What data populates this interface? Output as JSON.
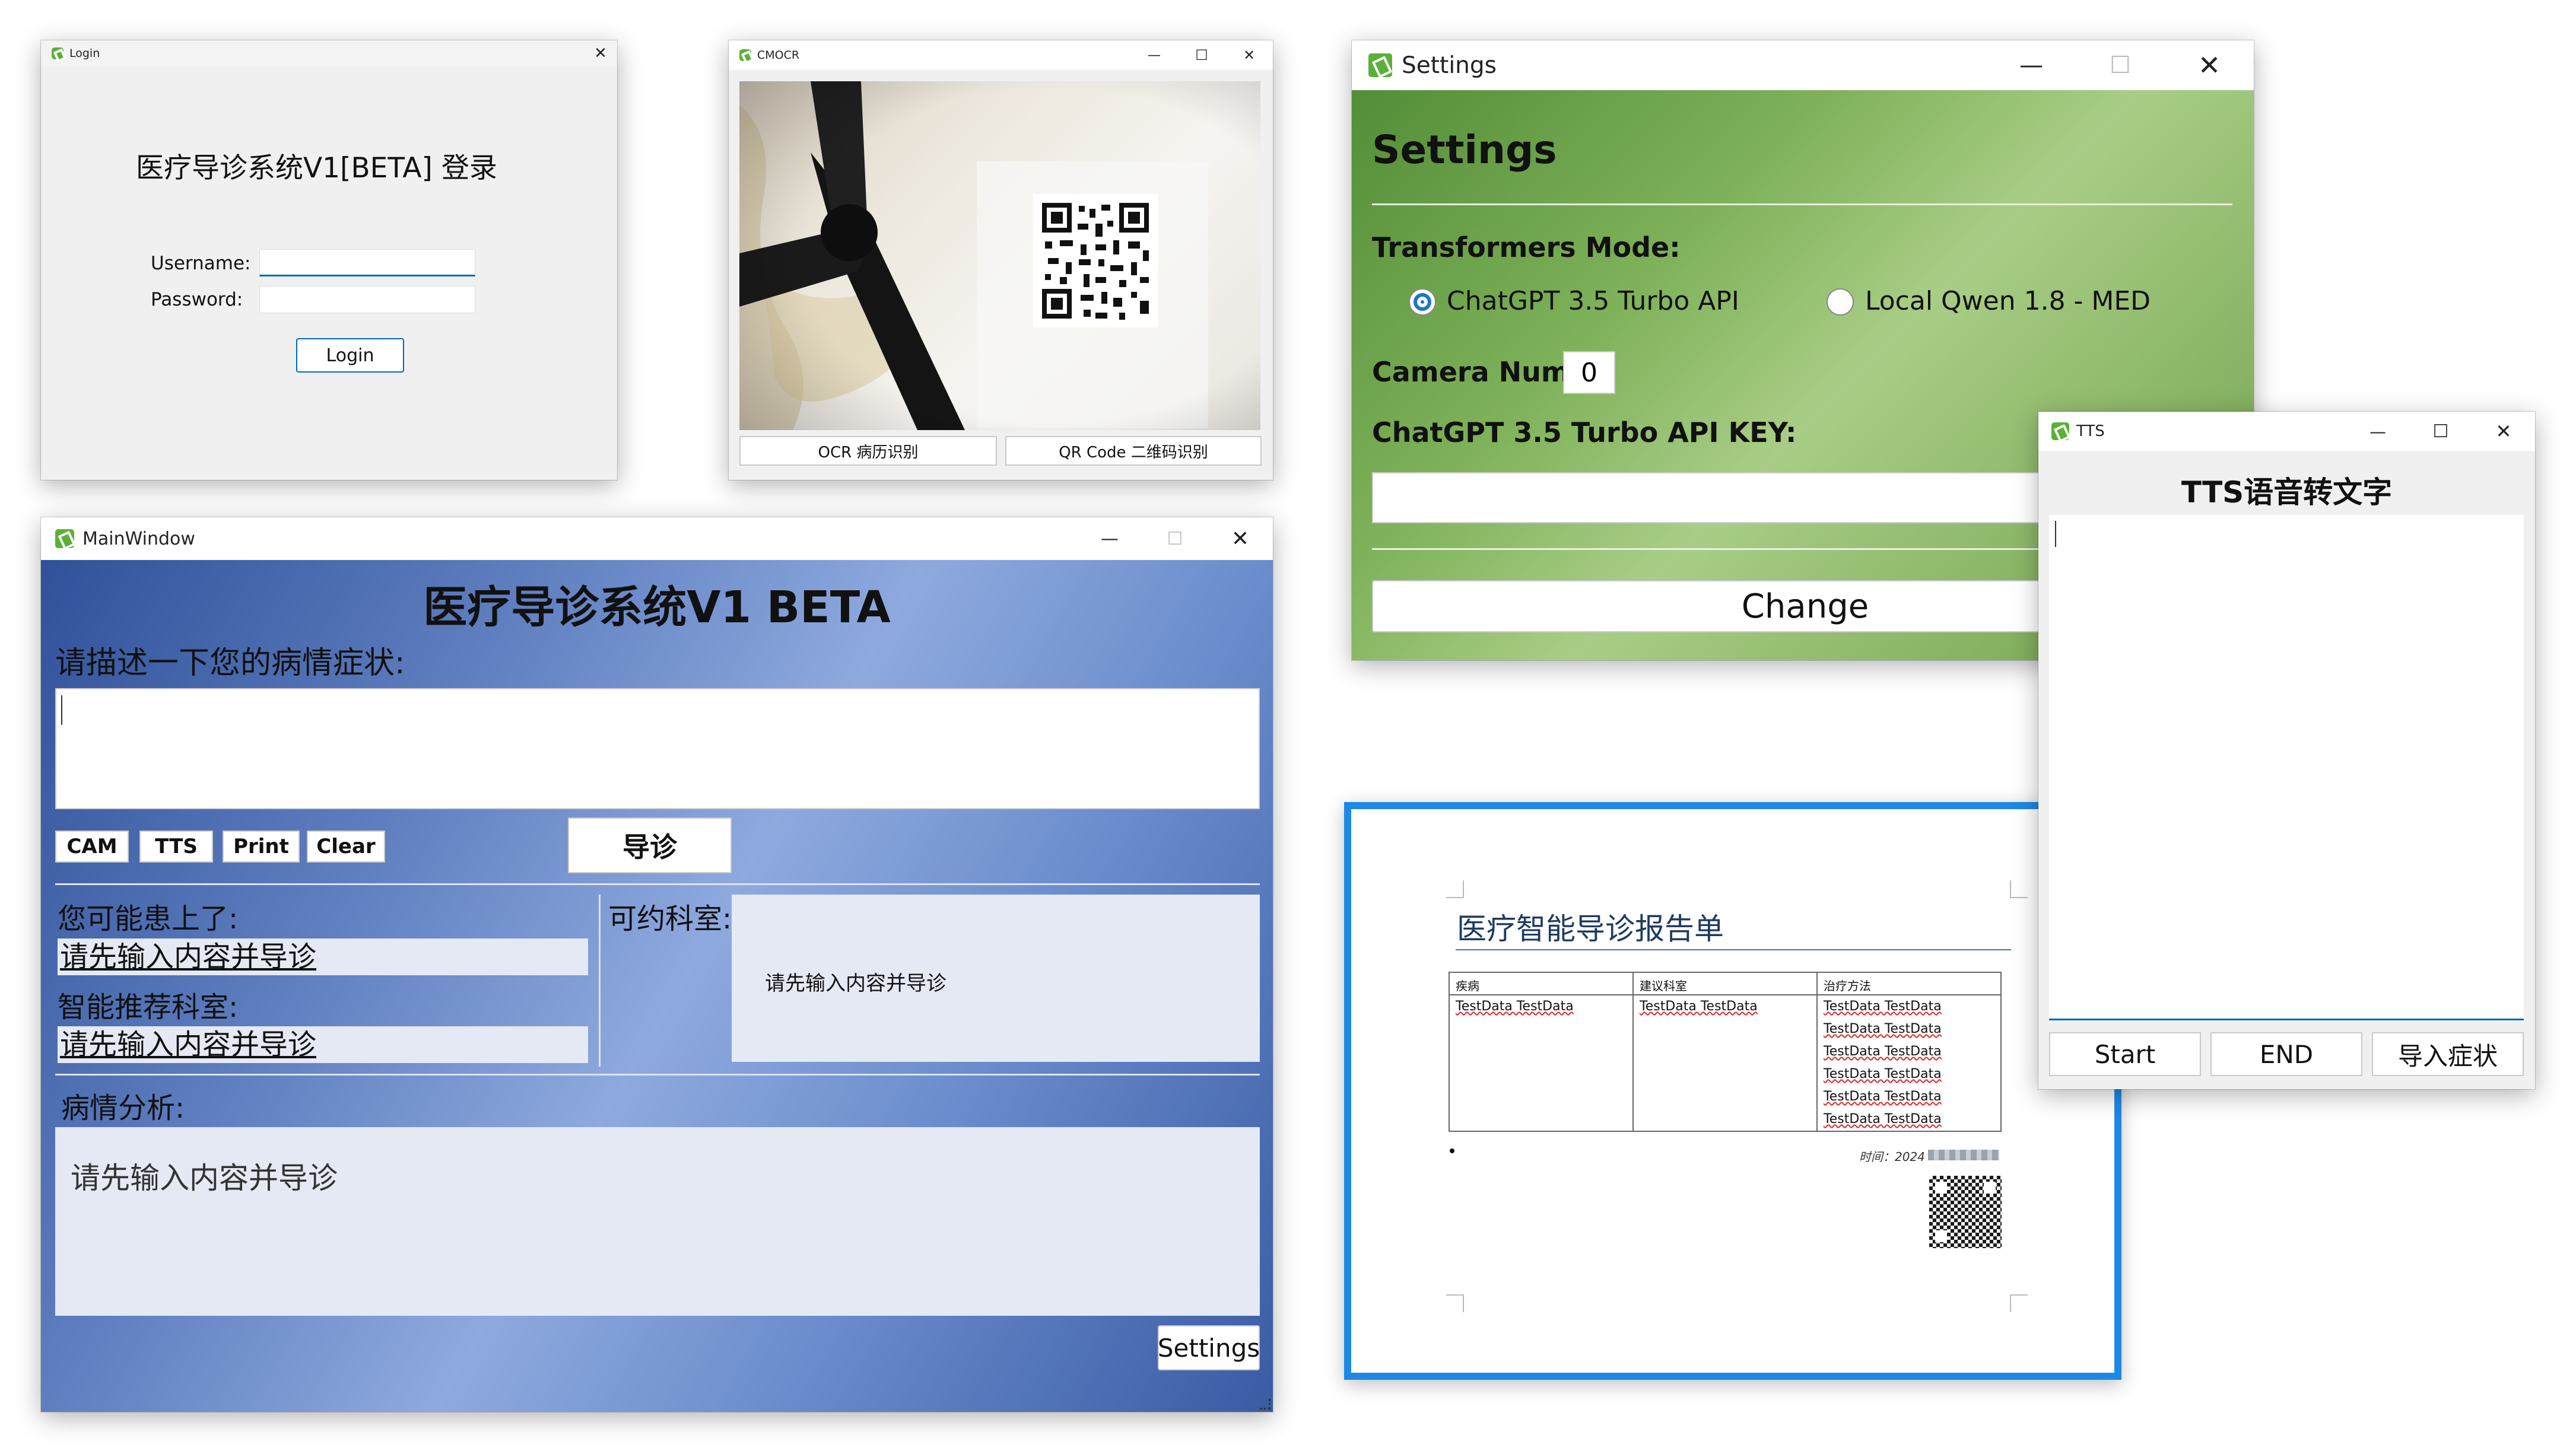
{
  "login": {
    "window_title": "Login",
    "heading": "医疗导诊系统V1[BETA] 登录",
    "username_label": "Username:",
    "password_label": "Password:",
    "username_value": "",
    "password_value": "",
    "login_button": "Login"
  },
  "cmocr": {
    "window_title": "CMOCR",
    "ocr_button": "OCR 病历识别",
    "qr_button": "QR Code 二维码识别"
  },
  "settings": {
    "window_title": "Settings",
    "heading": "Settings",
    "mode_label": "Transformers Mode:",
    "mode_options": [
      "ChatGPT 3.5 Turbo API",
      "Local Qwen 1.8 - MED"
    ],
    "selected_mode": "ChatGPT 3.5 Turbo API",
    "camera_label": "Camera Num:",
    "camera_value": "0",
    "api_key_label": "ChatGPT 3.5 Turbo API KEY:",
    "api_key_value": "",
    "change_button": "Change",
    "gradient_colors": [
      "#4f8a34",
      "#a9cd86"
    ]
  },
  "main": {
    "window_title": "MainWindow",
    "title": "医疗导诊系统V1 BETA",
    "describe_label": "请描述一下您的病情症状:",
    "describe_value": "",
    "buttons": {
      "cam": "CAM",
      "tts": "TTS",
      "print": "Print",
      "clear": "Clear",
      "diagnose": "导诊"
    },
    "possible_label": "您可能患上了:",
    "possible_value": "请先输入内容并导诊",
    "dept_label": "智能推荐科室:",
    "dept_value": "请先输入内容并导诊",
    "bookable_label": "可约科室:",
    "bookable_value": "请先输入内容并导诊",
    "analysis_label": "病情分析:",
    "analysis_value": "请先输入内容并导诊",
    "settings_button": "Settings",
    "gradient_colors": [
      "#2e4f98",
      "#8ea9de"
    ]
  },
  "report": {
    "title": "医疗智能导诊报告单",
    "headers": [
      "疾病",
      "建议科室",
      "治疗方法"
    ],
    "col1": [
      "TestData TestData"
    ],
    "col2": [
      "TestData TestData"
    ],
    "col3": [
      "TestData TestData",
      "TestData TestData",
      "TestData TestData",
      "TestData TestData",
      "TestData TestData",
      "TestData TestData"
    ],
    "time_label": "时间：2024",
    "border_color": "#1e88e5"
  },
  "tts": {
    "window_title": "TTS",
    "heading": "TTS语音转文字",
    "text_value": "",
    "start_button": "Start",
    "end_button": "END",
    "import_button": "导入症状"
  }
}
